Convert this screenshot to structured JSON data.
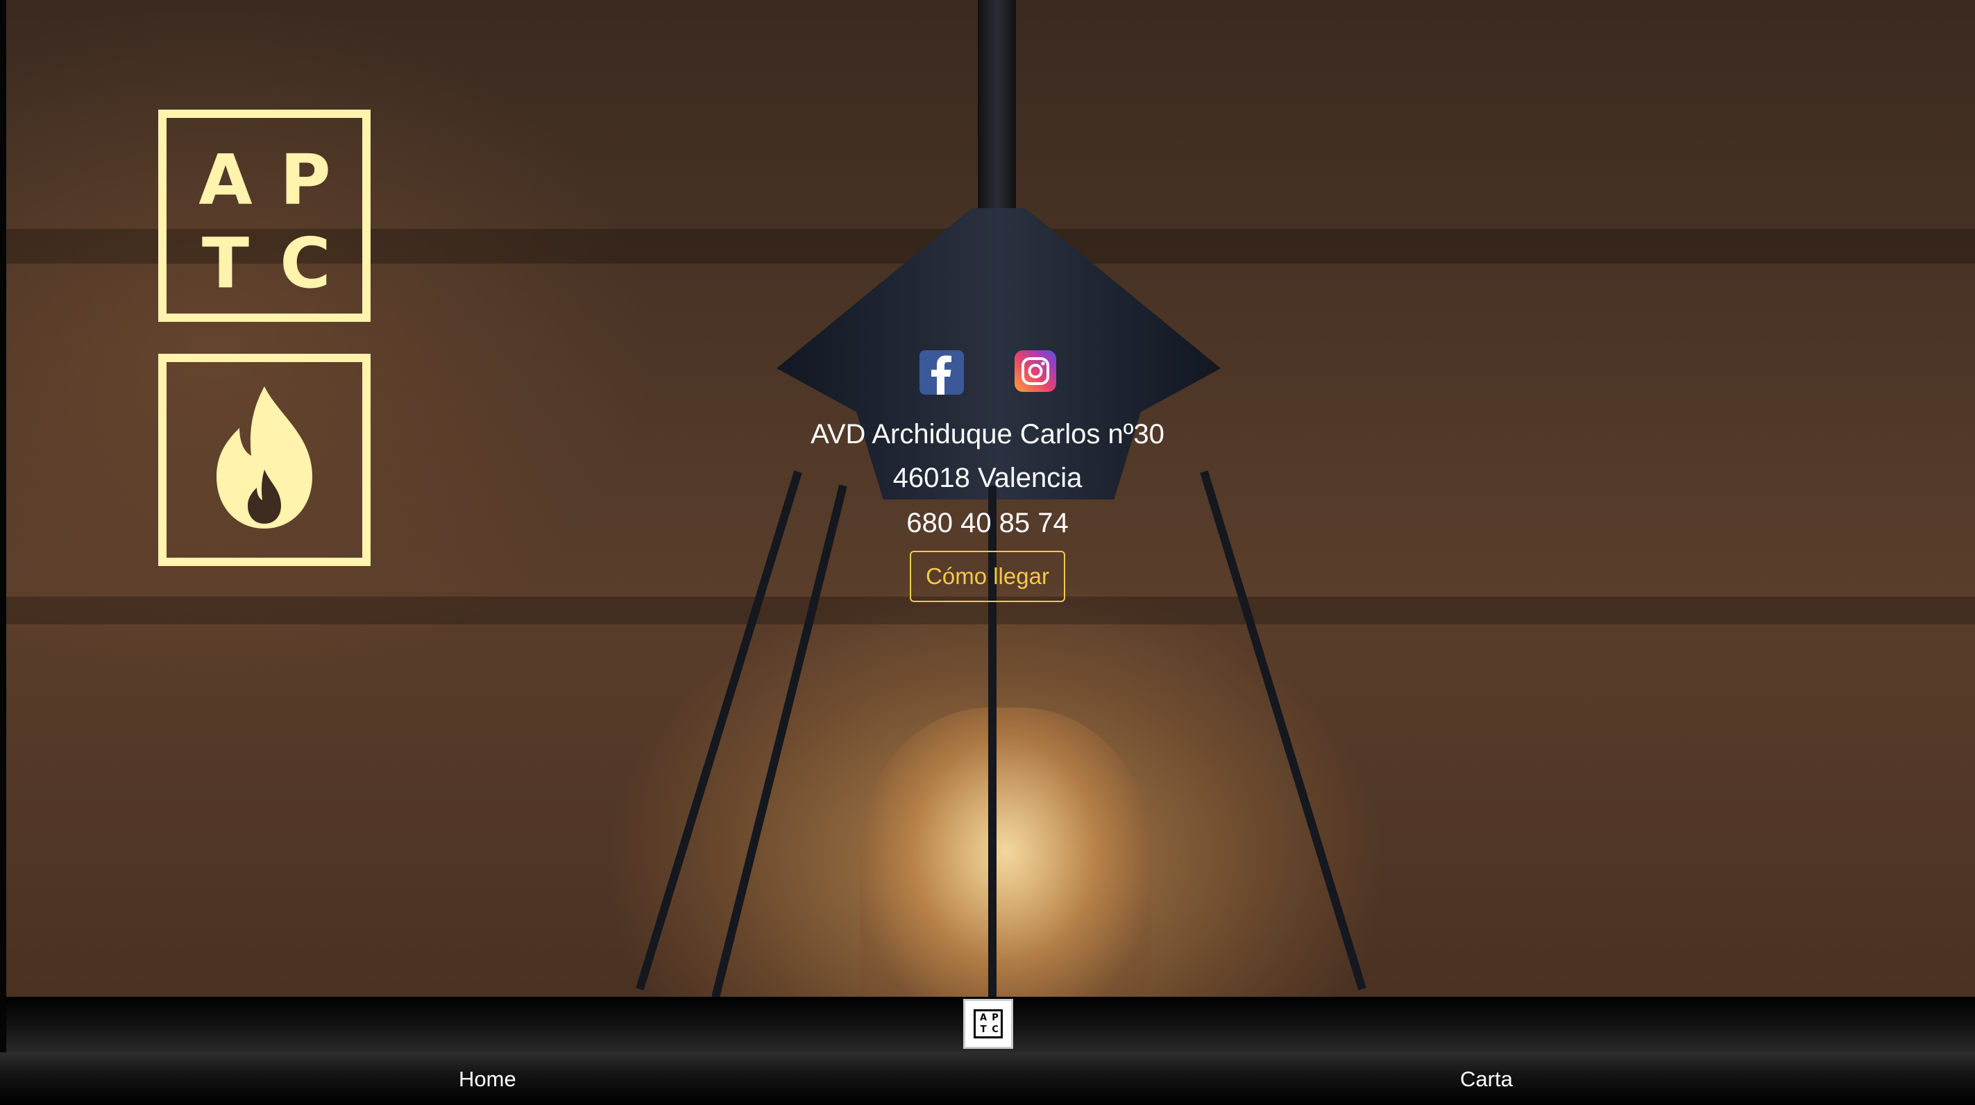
{
  "logo": {
    "letters": [
      "A",
      "P",
      "T",
      "C"
    ]
  },
  "social": {
    "facebook_icon": "facebook-icon",
    "instagram_icon": "instagram-icon"
  },
  "info": {
    "address_line1": "AVD Archiduque Carlos nº30",
    "address_line2": "46018 Valencia",
    "phone": "680 40 85 74",
    "directions_button": "Cómo llegar"
  },
  "nav": {
    "logo_letters": [
      "A",
      "P",
      "T",
      "C"
    ],
    "items": [
      {
        "label": "Home"
      },
      {
        "label": "Carta"
      }
    ]
  },
  "colors": {
    "accent_yellow": "#fff3ad",
    "button_gold": "#f2c94c",
    "text_white": "#ffffff"
  }
}
